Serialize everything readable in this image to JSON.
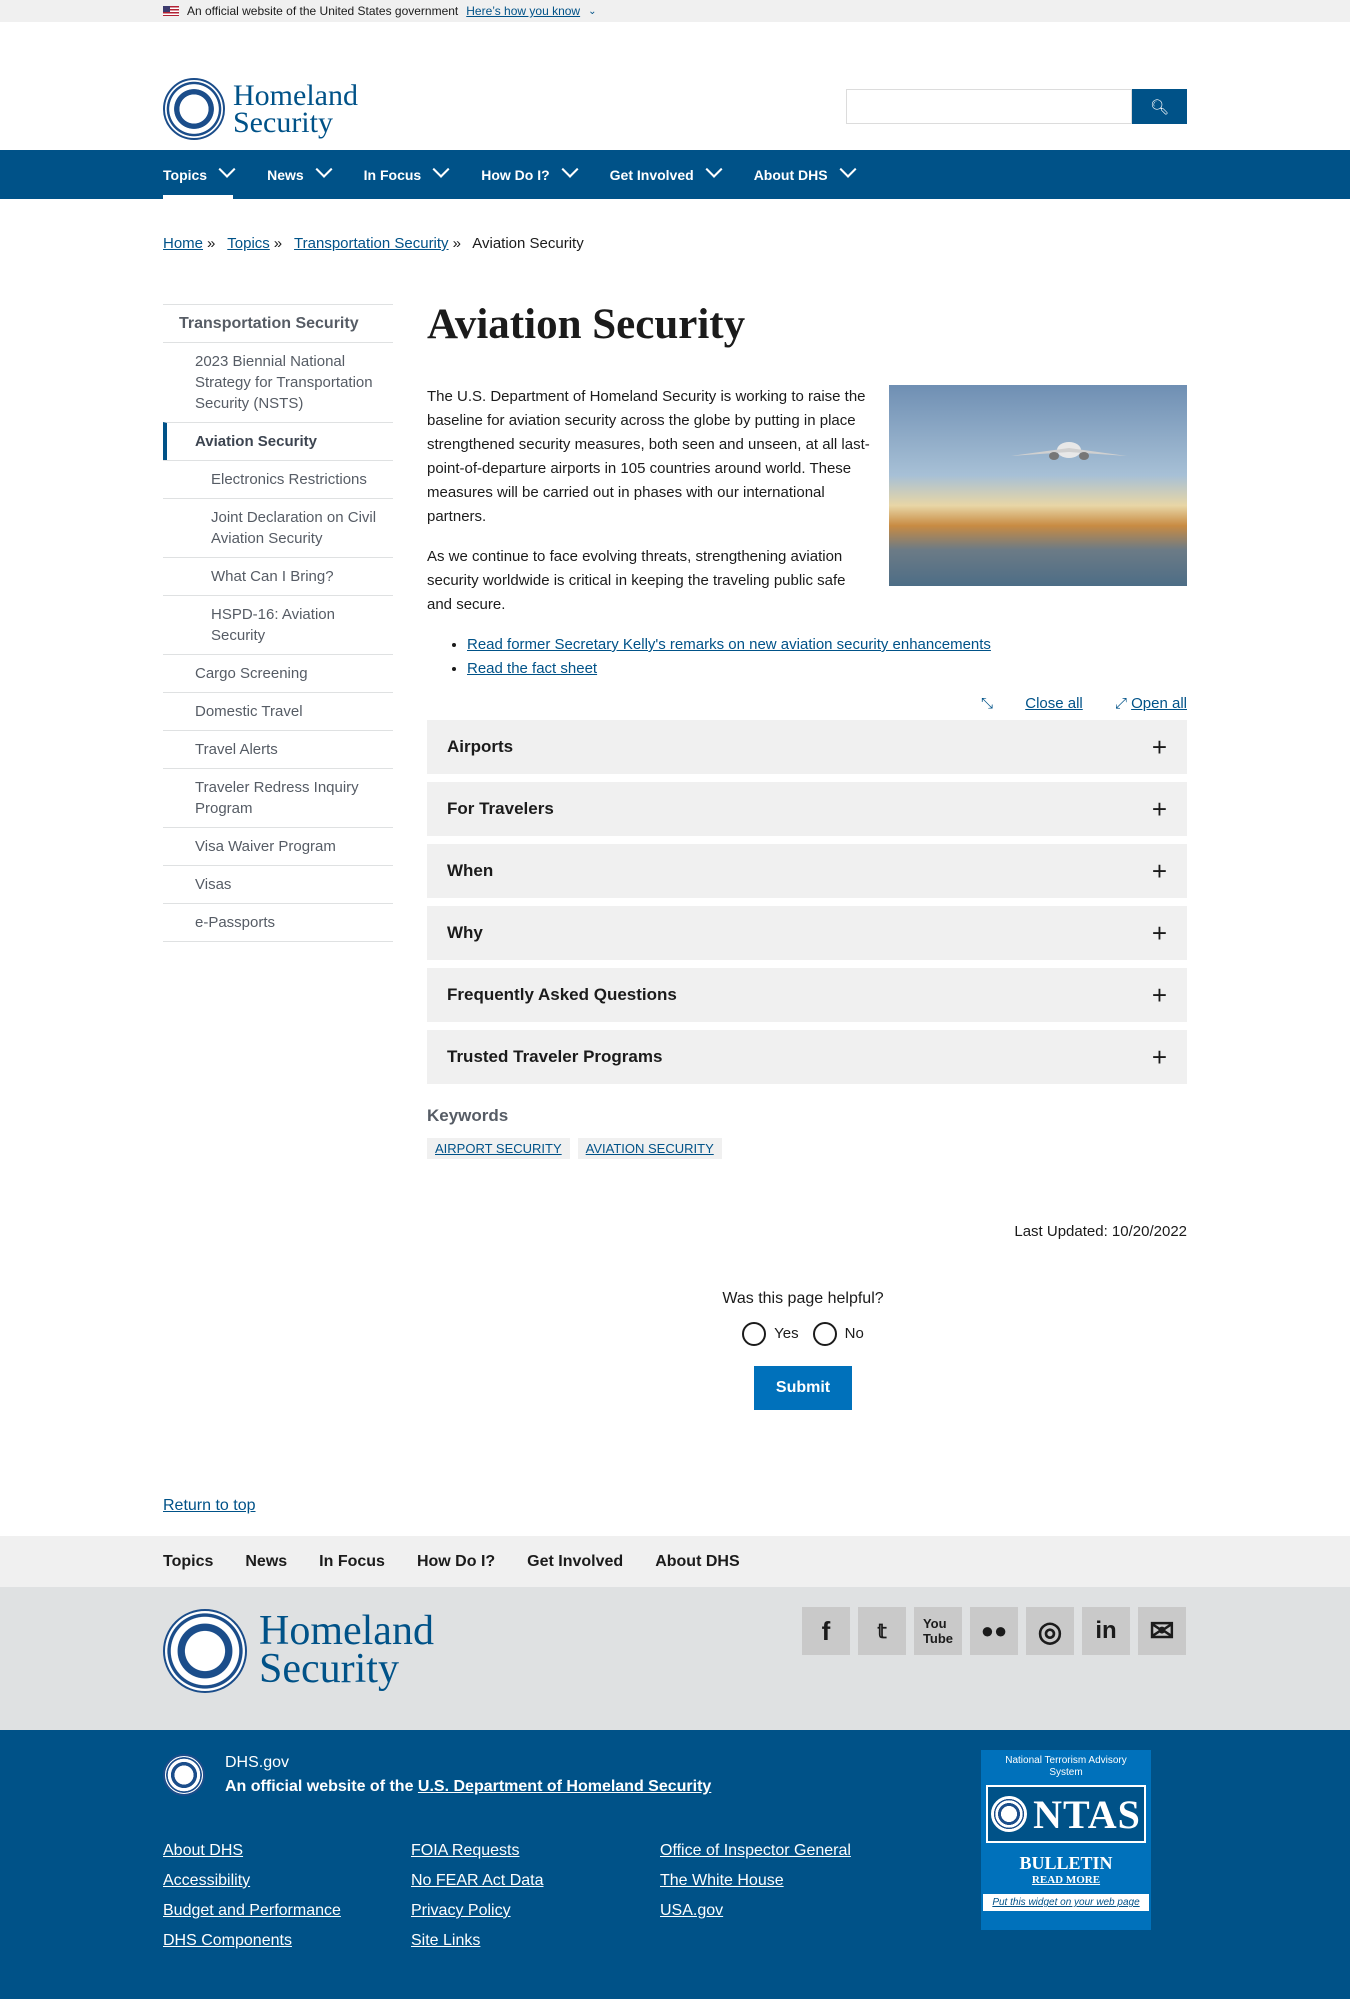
{
  "banner": {
    "text": "An official website of the United States government",
    "link": "Here’s how you know"
  },
  "header": {
    "logo_line1": "Homeland",
    "logo_line2": "Security",
    "search_icon": "search-icon"
  },
  "nav": [
    "Topics",
    "News",
    "In Focus",
    "How Do I?",
    "Get Involved",
    "About DHS"
  ],
  "breadcrumb": {
    "home": "Home",
    "topics": "Topics",
    "parent": "Transportation Security",
    "current": "Aviation Security"
  },
  "sidenav": [
    "Transportation Security",
    "2023 Biennial National Strategy for Transportation Security (NSTS)",
    "Aviation Security",
    "Electronics Restrictions",
    "Joint Declaration on Civil Aviation Security",
    "What Can I Bring?",
    "HSPD-16: Aviation Security",
    "Cargo Screening",
    "Domestic Travel",
    "Travel Alerts",
    "Traveler Redress Inquiry Program",
    "Visa Waiver Program",
    "Visas",
    "e-Passports"
  ],
  "main": {
    "title": "Aviation Security",
    "p1": "The U.S. Department of Homeland Security is working to raise the baseline for aviation security across the globe by putting in place strengthened security measures, both seen and unseen, at all last-point-of-departure airports in 105 countries around world. These measures will be carried out in phases with our international partners.",
    "p2": "As we continue to face evolving threats, strengthening aviation security worldwide is critical in keeping the traveling public safe and secure.",
    "links": [
      "Read former Secretary Kelly's remarks on new aviation security enhancements",
      "Read the fact sheet"
    ],
    "close_all": "Close all",
    "open_all": "Open all",
    "accordions": [
      "Airports",
      "For Travelers",
      "When",
      "Why",
      "Frequently Asked Questions",
      "Trusted Traveler Programs"
    ],
    "keywords_title": "Keywords",
    "keywords": [
      "AIRPORT SECURITY",
      "AVIATION SECURITY"
    ],
    "updated": "Last Updated: 10/20/2022"
  },
  "feedback": {
    "question": "Was this page helpful?",
    "yes": "Yes",
    "no": "No",
    "submit": "Submit"
  },
  "footer": {
    "return_top": "Return to top",
    "nav": [
      "Topics",
      "News",
      "In Focus",
      "How Do I?",
      "Get Involved",
      "About DHS"
    ],
    "site": "DHS.gov",
    "official_prefix": "An official website of the",
    "official_link": "U.S. Department of Homeland Security",
    "col1": [
      "About DHS",
      "Accessibility",
      "Budget and Performance",
      "DHS Components"
    ],
    "col2": [
      "FOIA Requests",
      "No FEAR Act Data",
      "Privacy Policy",
      "Site Links"
    ],
    "col3": [
      "Office of Inspector General",
      "The White House",
      "USA.gov"
    ],
    "ntas": {
      "title": "National Terrorism Advisory System",
      "logo": "NTAS",
      "bulletin": "BULLETIN",
      "read_more": "READ MORE",
      "widget": "Put this widget on your web page"
    }
  }
}
